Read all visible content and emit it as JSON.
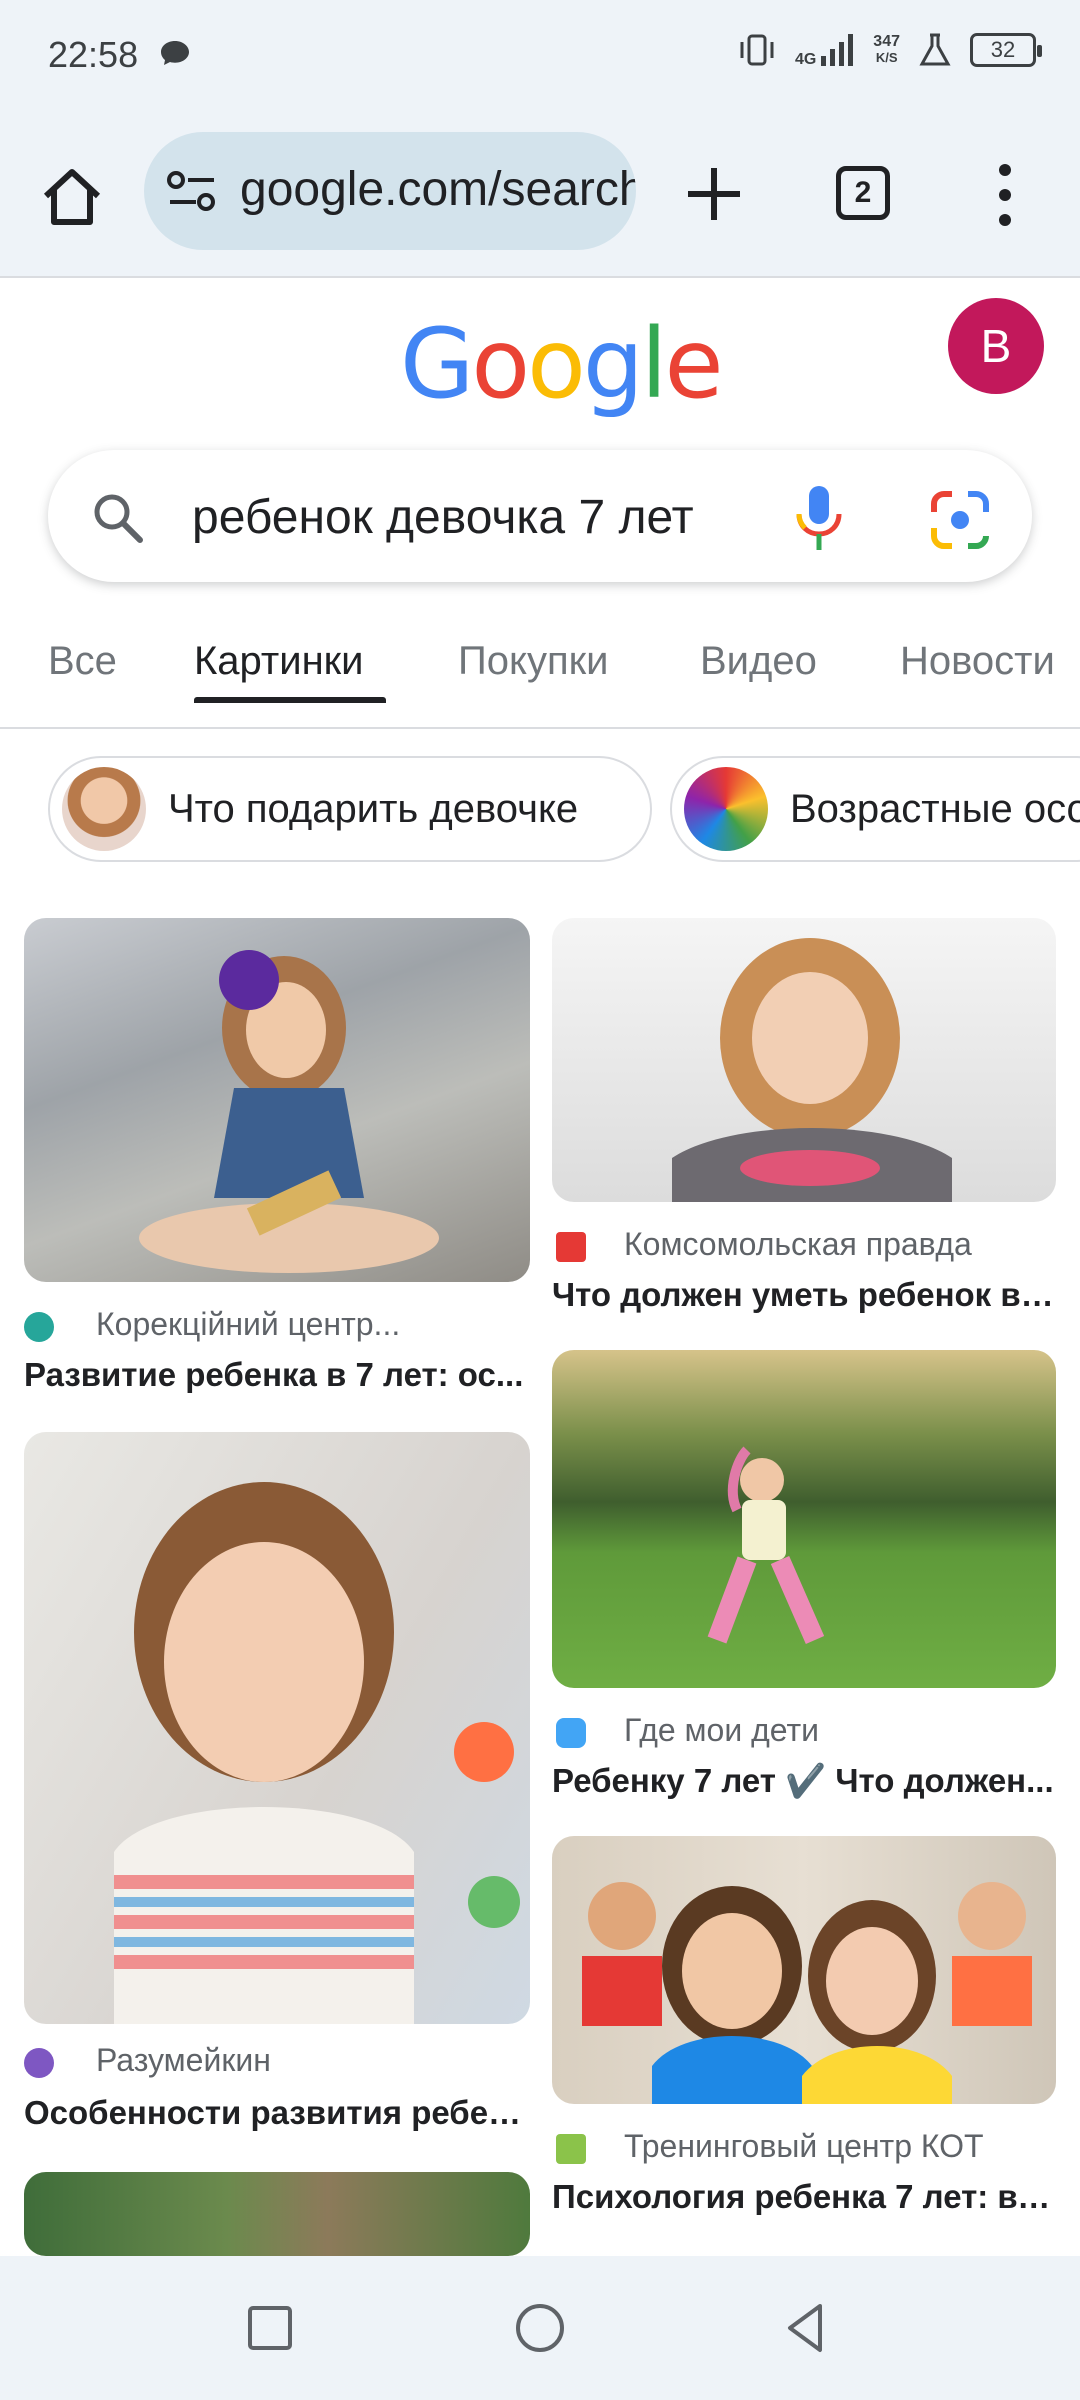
{
  "status": {
    "time": "22:58",
    "network_top": "4G",
    "speed": "347",
    "speed_unit": "K/S",
    "battery": "32"
  },
  "browser": {
    "url": "google.com/search",
    "tab_count": "2"
  },
  "header": {
    "logo_letters": [
      "G",
      "o",
      "o",
      "g",
      "l",
      "e"
    ],
    "logo_colors": [
      "#4285F4",
      "#EA4335",
      "#FBBC05",
      "#4285F4",
      "#34A853",
      "#EA4335"
    ],
    "avatar_letter": "B"
  },
  "search": {
    "query": "ребенок девочка 7 лет"
  },
  "tabs": [
    {
      "label": "Все",
      "active": false
    },
    {
      "label": "Картинки",
      "active": true
    },
    {
      "label": "Покупки",
      "active": false
    },
    {
      "label": "Видео",
      "active": false
    },
    {
      "label": "Новости",
      "active": false
    }
  ],
  "chips": [
    {
      "label": "Что подарить девочке"
    },
    {
      "label": "Возрастные особенности"
    }
  ],
  "results": [
    {
      "source": "Корекційний центр...",
      "title": "Развитие ребенка в 7 лет: ос...",
      "icon": "brain-logo-icon"
    },
    {
      "source": "Комсомольская правда",
      "title": "Что должен уметь ребенок в ...",
      "icon": "kp-bird-logo-icon"
    },
    {
      "source": "Разумейкин",
      "title": "Особенности развития ребен...",
      "icon": "razumeykin-logo-icon"
    },
    {
      "source": "Где мои дети",
      "title": "Ребенку 7 лет ✔️ Что должен...",
      "icon": "where-kids-logo-icon"
    },
    {
      "source": "Тренинговый центр КОТ",
      "title": "Психология ребенка 7 лет: во...",
      "icon": "kot-logo-icon"
    }
  ],
  "colors": {
    "chrome_bg": "#eef3f8",
    "url_bg": "#d3e3ec",
    "avatar": "#c2185b",
    "text": "#202124",
    "muted": "#5f6368"
  }
}
